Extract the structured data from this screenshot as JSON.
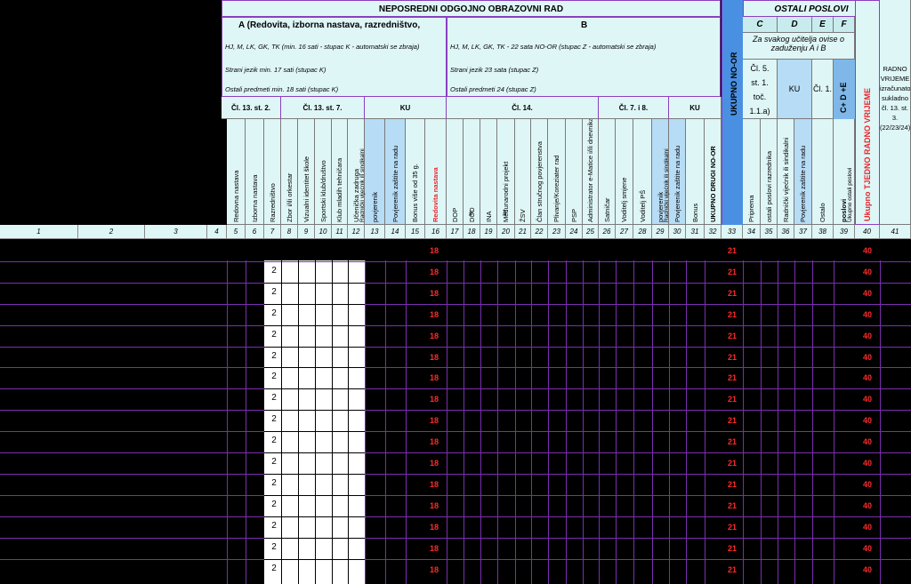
{
  "header": {
    "main_title": "NEPOSREDNI ODGOJNO OBRAZOVNI RAD",
    "section_a_title": "A (Redovita, izborna nastava, razredništvo,",
    "section_a_line1": "HJ, M, LK, GK, TK  (min. 16 sati - stupac K - automatski se zbraja)",
    "section_a_line2": "Strani jezik min. 17 sati (stupac K)",
    "section_a_line3": "Ostali predmeti min. 18 sati (stupac K)",
    "section_b_title": "B",
    "section_b_line1": "HJ, M, LK, GK, TK - 22 sata NO-OR (stupac Z - automatski se zbraja)",
    "section_b_line2": "Strani jezik 23 sata  (stupac Z)",
    "section_b_line3": "Ostali predmeti 24 (stupac Z)",
    "ostali_title": "OSTALI POSLOVI",
    "col_c": "C",
    "col_d": "D",
    "col_e": "E",
    "col_f": "F",
    "ostali_note": "Za svakog učitelja ovise o zaduženju  A i B",
    "cl5": "Čl. 5. st. 1. toč. 1.1.a)",
    "ku_d": "KU",
    "cl1": "Čl. 1.",
    "cde": "C+ D +E",
    "ukupno_tjedno": "Ukupno TJEDNO RADNO VRIJEME",
    "radno_vrijeme_note": "RADNO VRIJEME izračunato sukladno čl. 13. st. 3. (22/23/24)",
    "ukupno_no_or": "UKUPNO NO-OR",
    "sub_cl13_st2": "Čl. 13. st. 2.",
    "sub_cl13_st7": "Čl. 13. st. 7.",
    "sub_ku_a": "KU",
    "sub_cl14": "Čl. 14.",
    "sub_cl7i8": "Čl. 7. i 8.",
    "sub_ku_b": "KU"
  },
  "columns": [
    {
      "num": "1",
      "label": ""
    },
    {
      "num": "2",
      "label": ""
    },
    {
      "num": "3",
      "label": ""
    },
    {
      "num": "4",
      "label": ""
    },
    {
      "num": "5",
      "label": "Redovna nastava"
    },
    {
      "num": "6",
      "label": "Izborna nastava"
    },
    {
      "num": "7",
      "label": "Razredništvo"
    },
    {
      "num": "8",
      "label": "Zbor i/ili orkestar"
    },
    {
      "num": "9",
      "label": "Vizualni identitet škole"
    },
    {
      "num": "10",
      "label": "Sportski klub/društvo"
    },
    {
      "num": "11",
      "label": "Klub mladih tehničara"
    },
    {
      "num": "12",
      "label": "Učenička zadruga"
    },
    {
      "num": "13",
      "label": "povjerenik"
    },
    {
      "num": "14",
      "label": "Povjerenik zaštite na radu"
    },
    {
      "num": "15",
      "label": "Bonus više od 35 g."
    },
    {
      "num": "16",
      "label": "Redovita nastava"
    },
    {
      "num": "17",
      "label": "DOP"
    },
    {
      "num": "18",
      "label": "DOD"
    },
    {
      "num": "19",
      "label": "INA"
    },
    {
      "num": "20",
      "label": "Međunarodni projekt"
    },
    {
      "num": "21",
      "label": "ŽSV"
    },
    {
      "num": "22",
      "label": "Član stručnog povjerenstva"
    },
    {
      "num": "23",
      "label": "Plivanje/Koreziater rad"
    },
    {
      "num": "24",
      "label": "PSP"
    },
    {
      "num": "25",
      "label": "Administrator e-Matice i/ili dnevnika"
    },
    {
      "num": "26",
      "label": "Satničar"
    },
    {
      "num": "27",
      "label": "Voditelj smjene"
    },
    {
      "num": "28",
      "label": "Voditelj PŠ"
    },
    {
      "num": "29",
      "label": "povjerenik"
    },
    {
      "num": "30",
      "label": "Povjerenik zaštite na radu"
    },
    {
      "num": "31",
      "label": "Bonus"
    },
    {
      "num": "32",
      "label": "UKUPNO DRUGI NO-OR"
    },
    {
      "num": "33",
      "label": ""
    },
    {
      "num": "34",
      "label": "Priprema"
    },
    {
      "num": "35",
      "label": "ostali poslovi razrednika"
    },
    {
      "num": "36",
      "label": "Radnički vijećnik ili sindikalni"
    },
    {
      "num": "37",
      "label": "Povjerenik zaštite na radu"
    },
    {
      "num": "38",
      "label": "Ostalo"
    },
    {
      "num": "39",
      "label": "poslovi"
    },
    {
      "num": "40",
      "label": ""
    },
    {
      "num": "41",
      "label": ""
    }
  ],
  "extra_labels": {
    "c12_top": "Radnički vijećnik ili sindikalni",
    "c29_top": "Radnički vijećnik ili sindikalni",
    "c39_top": "Ukupno ostali poslovi",
    "c18_hash": "#",
    "c20_hash": "#"
  },
  "rows": {
    "count": 16,
    "razrednistvo": "2",
    "redovita": "18",
    "ukupno_no_or": "21",
    "tjedno": "40"
  }
}
